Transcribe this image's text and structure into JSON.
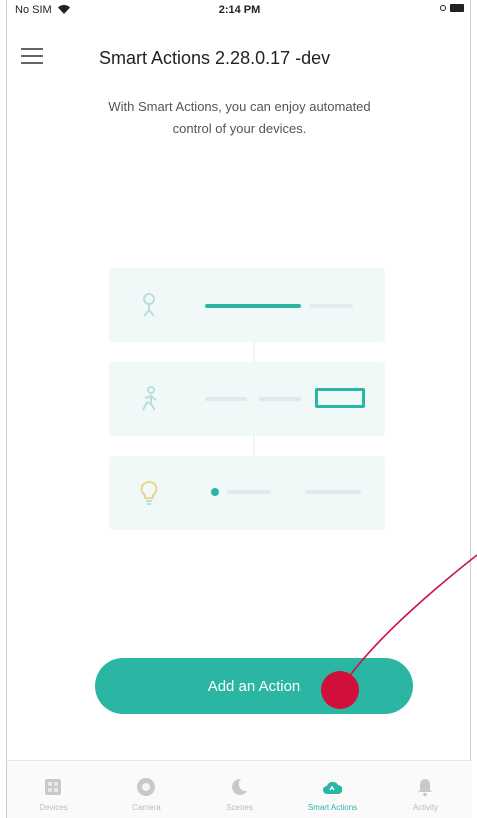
{
  "status_bar": {
    "carrier": "No SIM",
    "time": "2:14 PM"
  },
  "header": {
    "title": "Smart Actions 2.28.0.17 -dev"
  },
  "intro": {
    "line1": "With Smart Actions, you can enjoy automated",
    "line2": "control of your devices."
  },
  "main": {
    "add_action_label": "Add an Action"
  },
  "tabs": [
    {
      "label": "Devices",
      "icon": "devices-icon",
      "active": false
    },
    {
      "label": "Camera",
      "icon": "camera-icon",
      "active": false
    },
    {
      "label": "Scenes",
      "icon": "moon-icon",
      "active": false
    },
    {
      "label": "Smart Actions",
      "icon": "cloud-icon",
      "active": true
    },
    {
      "label": "Activity",
      "icon": "bell-icon",
      "active": false
    }
  ],
  "colors": {
    "accent": "#2ab6a3",
    "annotation": "#cc1144"
  }
}
